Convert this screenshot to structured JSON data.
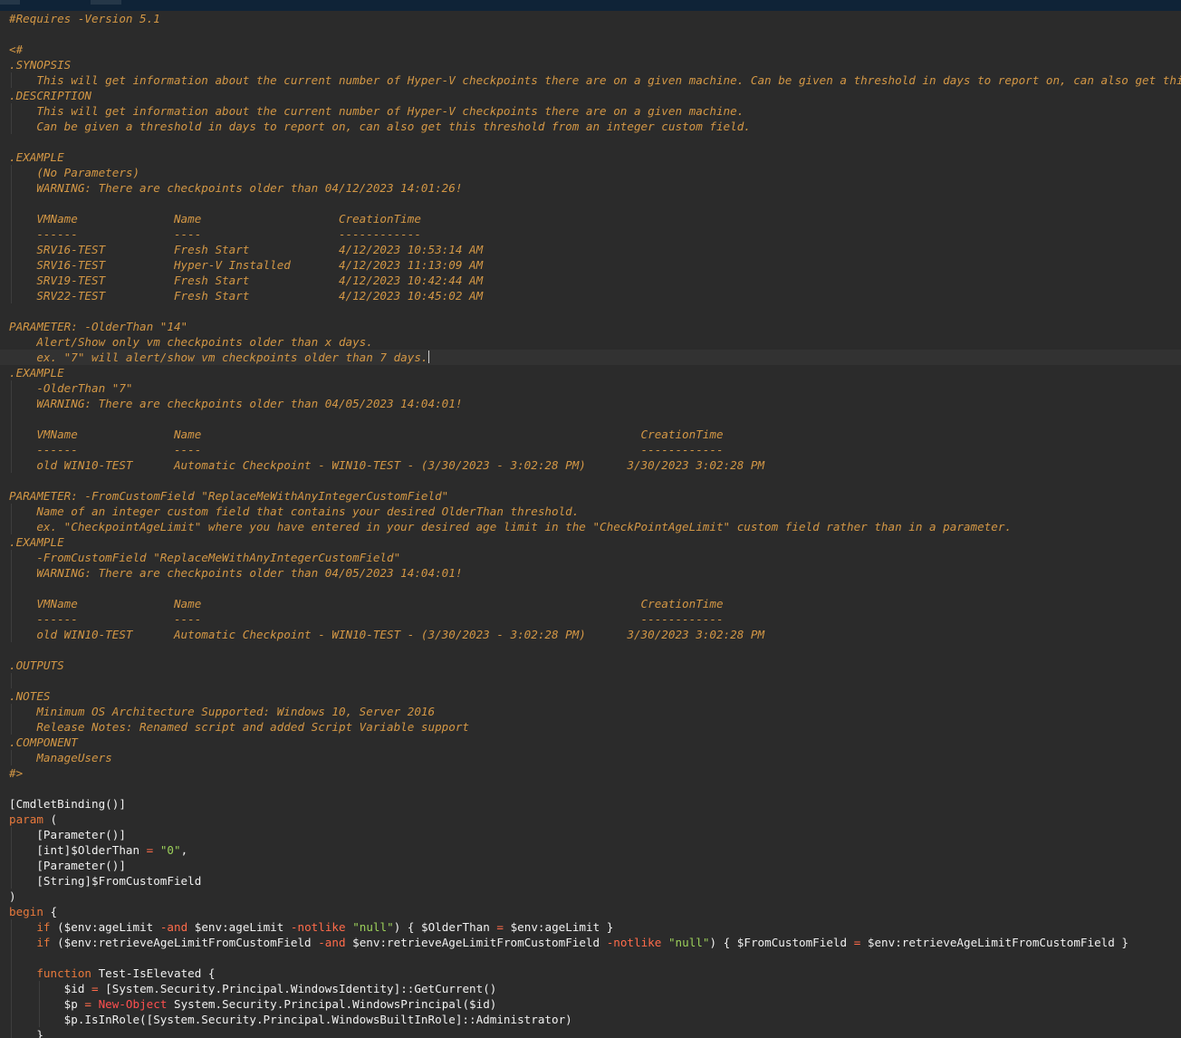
{
  "editor": {
    "language": "powershell",
    "theme_colors": {
      "background": "#2b2b2b",
      "comment": "#d39745",
      "keyword": "#e8793c",
      "string": "#9cd05a",
      "operator": "#ff6b4a"
    },
    "lines": [
      {
        "indent": 0,
        "tokens": [
          [
            "cm",
            "#Requires -Version 5.1"
          ]
        ]
      },
      {
        "indent": 0,
        "tokens": []
      },
      {
        "indent": 0,
        "tokens": [
          [
            "cm",
            "<#"
          ]
        ]
      },
      {
        "indent": 0,
        "tokens": [
          [
            "cm",
            ".SYNOPSIS"
          ]
        ]
      },
      {
        "indent": 1,
        "tokens": [
          [
            "cm",
            "    This will get information about the current number of Hyper-V checkpoints there are on a given machine. Can be given a threshold in days to report on, can also get this threshold from an integer custom field."
          ]
        ]
      },
      {
        "indent": 0,
        "tokens": [
          [
            "cm",
            ".DESCRIPTION"
          ]
        ]
      },
      {
        "indent": 1,
        "tokens": [
          [
            "cm",
            "    This will get information about the current number of Hyper-V checkpoints there are on a given machine."
          ]
        ]
      },
      {
        "indent": 1,
        "tokens": [
          [
            "cm",
            "    Can be given a threshold in days to report on, can also get this threshold from an integer custom field."
          ]
        ]
      },
      {
        "indent": 0,
        "tokens": []
      },
      {
        "indent": 0,
        "tokens": [
          [
            "cm",
            ".EXAMPLE"
          ]
        ]
      },
      {
        "indent": 1,
        "tokens": [
          [
            "cm",
            "    (No Parameters)"
          ]
        ]
      },
      {
        "indent": 1,
        "tokens": [
          [
            "cm",
            "    WARNING: There are checkpoints older than 04/12/2023 14:01:26!"
          ]
        ]
      },
      {
        "indent": 1,
        "tokens": []
      },
      {
        "indent": 1,
        "tokens": [
          [
            "cm",
            "    VMName              Name                    CreationTime"
          ]
        ]
      },
      {
        "indent": 1,
        "tokens": [
          [
            "cm",
            "    ------              ----                    ------------"
          ]
        ]
      },
      {
        "indent": 1,
        "tokens": [
          [
            "cm",
            "    SRV16-TEST          Fresh Start             4/12/2023 10:53:14 AM"
          ]
        ]
      },
      {
        "indent": 1,
        "tokens": [
          [
            "cm",
            "    SRV16-TEST          Hyper-V Installed       4/12/2023 11:13:09 AM"
          ]
        ]
      },
      {
        "indent": 1,
        "tokens": [
          [
            "cm",
            "    SRV19-TEST          Fresh Start             4/12/2023 10:42:44 AM"
          ]
        ]
      },
      {
        "indent": 1,
        "tokens": [
          [
            "cm",
            "    SRV22-TEST          Fresh Start             4/12/2023 10:45:02 AM"
          ]
        ]
      },
      {
        "indent": 0,
        "tokens": []
      },
      {
        "indent": 0,
        "tokens": [
          [
            "cm",
            "PARAMETER: -OlderThan \"14\""
          ]
        ]
      },
      {
        "indent": 0,
        "tokens": [
          [
            "cm",
            "    Alert/Show only vm checkpoints older than x days."
          ]
        ]
      },
      {
        "indent": 0,
        "active": true,
        "caret": true,
        "tokens": [
          [
            "cm",
            "    ex. \"7\" will alert/show vm checkpoints older than 7 days."
          ]
        ]
      },
      {
        "indent": 0,
        "tokens": [
          [
            "cm",
            ".EXAMPLE"
          ]
        ]
      },
      {
        "indent": 1,
        "tokens": [
          [
            "cm",
            "    -OlderThan \"7\""
          ]
        ]
      },
      {
        "indent": 1,
        "tokens": [
          [
            "cm",
            "    WARNING: There are checkpoints older than 04/05/2023 14:04:01!"
          ]
        ]
      },
      {
        "indent": 1,
        "tokens": []
      },
      {
        "indent": 1,
        "tokens": [
          [
            "cm",
            "    VMName              Name                                                                CreationTime"
          ]
        ]
      },
      {
        "indent": 1,
        "tokens": [
          [
            "cm",
            "    ------              ----                                                                ------------"
          ]
        ]
      },
      {
        "indent": 1,
        "tokens": [
          [
            "cm",
            "    old WIN10-TEST      Automatic Checkpoint - WIN10-TEST - (3/30/2023 - 3:02:28 PM)      3/30/2023 3:02:28 PM"
          ]
        ]
      },
      {
        "indent": 0,
        "tokens": []
      },
      {
        "indent": 0,
        "tokens": [
          [
            "cm",
            "PARAMETER: -FromCustomField \"ReplaceMeWithAnyIntegerCustomField\""
          ]
        ]
      },
      {
        "indent": 1,
        "tokens": [
          [
            "cm",
            "    Name of an integer custom field that contains your desired OlderThan threshold."
          ]
        ]
      },
      {
        "indent": 1,
        "tokens": [
          [
            "cm",
            "    ex. \"CheckpointAgeLimit\" where you have entered in your desired age limit in the \"CheckPointAgeLimit\" custom field rather than in a parameter."
          ]
        ]
      },
      {
        "indent": 0,
        "tokens": [
          [
            "cm",
            ".EXAMPLE"
          ]
        ]
      },
      {
        "indent": 1,
        "tokens": [
          [
            "cm",
            "    -FromCustomField \"ReplaceMeWithAnyIntegerCustomField\""
          ]
        ]
      },
      {
        "indent": 1,
        "tokens": [
          [
            "cm",
            "    WARNING: There are checkpoints older than 04/05/2023 14:04:01!"
          ]
        ]
      },
      {
        "indent": 1,
        "tokens": []
      },
      {
        "indent": 1,
        "tokens": [
          [
            "cm",
            "    VMName              Name                                                                CreationTime"
          ]
        ]
      },
      {
        "indent": 1,
        "tokens": [
          [
            "cm",
            "    ------              ----                                                                ------------"
          ]
        ]
      },
      {
        "indent": 1,
        "tokens": [
          [
            "cm",
            "    old WIN10-TEST      Automatic Checkpoint - WIN10-TEST - (3/30/2023 - 3:02:28 PM)      3/30/2023 3:02:28 PM"
          ]
        ]
      },
      {
        "indent": 0,
        "tokens": []
      },
      {
        "indent": 0,
        "tokens": [
          [
            "cm",
            ".OUTPUTS"
          ]
        ]
      },
      {
        "indent": 1,
        "tokens": []
      },
      {
        "indent": 0,
        "tokens": [
          [
            "cm",
            ".NOTES"
          ]
        ]
      },
      {
        "indent": 1,
        "tokens": [
          [
            "cm",
            "    Minimum OS Architecture Supported: Windows 10, Server 2016"
          ]
        ]
      },
      {
        "indent": 1,
        "tokens": [
          [
            "cm",
            "    Release Notes: Renamed script and added Script Variable support"
          ]
        ]
      },
      {
        "indent": 0,
        "tokens": [
          [
            "cm",
            ".COMPONENT"
          ]
        ]
      },
      {
        "indent": 1,
        "tokens": [
          [
            "cm",
            "    ManageUsers"
          ]
        ]
      },
      {
        "indent": 0,
        "tokens": [
          [
            "cm",
            "#>"
          ]
        ]
      },
      {
        "indent": 0,
        "tokens": []
      },
      {
        "indent": 0,
        "tokens": [
          [
            "tx",
            "[CmdletBinding()]"
          ]
        ]
      },
      {
        "indent": 0,
        "tokens": [
          [
            "kw",
            "param"
          ],
          [
            "tx",
            " ("
          ]
        ]
      },
      {
        "indent": 1,
        "tokens": [
          [
            "tx",
            "    [Parameter()]"
          ]
        ]
      },
      {
        "indent": 1,
        "tokens": [
          [
            "tx",
            "    [int]$OlderThan "
          ],
          [
            "opr",
            "="
          ],
          [
            "tx",
            " "
          ],
          [
            "str",
            "\"0\""
          ],
          [
            "tx",
            ","
          ]
        ]
      },
      {
        "indent": 1,
        "tokens": [
          [
            "tx",
            "    [Parameter()]"
          ]
        ]
      },
      {
        "indent": 1,
        "tokens": [
          [
            "tx",
            "    [String]$FromCustomField"
          ]
        ]
      },
      {
        "indent": 0,
        "tokens": [
          [
            "tx",
            ")"
          ]
        ]
      },
      {
        "indent": 0,
        "tokens": [
          [
            "kw",
            "begin"
          ],
          [
            "tx",
            " {"
          ]
        ]
      },
      {
        "indent": 1,
        "tokens": [
          [
            "tx",
            "    "
          ],
          [
            "kw",
            "if"
          ],
          [
            "tx",
            " ($env:ageLimit "
          ],
          [
            "opr",
            "-and"
          ],
          [
            "tx",
            " $env:ageLimit "
          ],
          [
            "opr",
            "-notlike"
          ],
          [
            "tx",
            " "
          ],
          [
            "str",
            "\"null\""
          ],
          [
            "tx",
            ") { $OlderThan "
          ],
          [
            "opr",
            "="
          ],
          [
            "tx",
            " $env:ageLimit }"
          ]
        ]
      },
      {
        "indent": 1,
        "tokens": [
          [
            "tx",
            "    "
          ],
          [
            "kw",
            "if"
          ],
          [
            "tx",
            " ($env:retrieveAgeLimitFromCustomField "
          ],
          [
            "opr",
            "-and"
          ],
          [
            "tx",
            " $env:retrieveAgeLimitFromCustomField "
          ],
          [
            "opr",
            "-notlike"
          ],
          [
            "tx",
            " "
          ],
          [
            "str",
            "\"null\""
          ],
          [
            "tx",
            ") { $FromCustomField "
          ],
          [
            "opr",
            "="
          ],
          [
            "tx",
            " $env:retrieveAgeLimitFromCustomField }"
          ]
        ]
      },
      {
        "indent": 1,
        "tokens": []
      },
      {
        "indent": 1,
        "tokens": [
          [
            "tx",
            "    "
          ],
          [
            "kw",
            "function"
          ],
          [
            "tx",
            " Test-IsElevated {"
          ]
        ]
      },
      {
        "indent": 2,
        "tokens": [
          [
            "tx",
            "        $id "
          ],
          [
            "opr",
            "="
          ],
          [
            "tx",
            " [System.Security.Principal.WindowsIdentity]::GetCurrent()"
          ]
        ]
      },
      {
        "indent": 2,
        "tokens": [
          [
            "tx",
            "        $p "
          ],
          [
            "opr",
            "="
          ],
          [
            "tx",
            " "
          ],
          [
            "new",
            "New-Object"
          ],
          [
            "tx",
            " System.Security.Principal.WindowsPrincipal($id)"
          ]
        ]
      },
      {
        "indent": 2,
        "tokens": [
          [
            "tx",
            "        $p.IsInRole([System.Security.Principal.WindowsBuiltInRole]::Administrator)"
          ]
        ]
      },
      {
        "indent": 1,
        "tokens": [
          [
            "tx",
            "    }"
          ]
        ]
      }
    ]
  }
}
